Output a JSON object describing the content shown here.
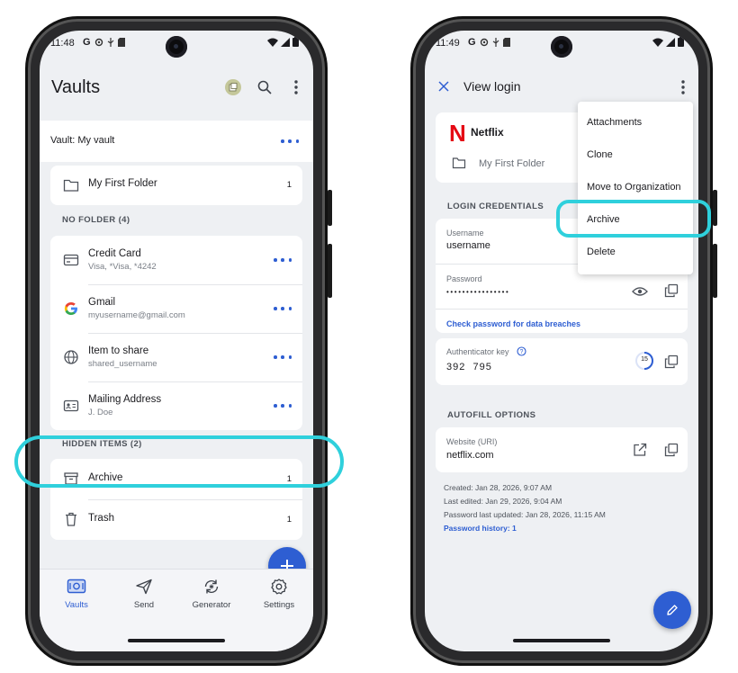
{
  "left_phone": {
    "status_time": "11:48",
    "status_icons": [
      "google-icon",
      "gear-icon",
      "usb-icon",
      "sim-icon"
    ],
    "title": "Vaults",
    "avatar_icon": "account-switch-icon",
    "vault_label": "Vault: My vault",
    "folder": {
      "name": "My First Folder",
      "count": "1"
    },
    "no_folder_label": "NO FOLDER (4)",
    "items": [
      {
        "icon": "card-icon",
        "title": "Credit Card",
        "subtitle": "Visa, *Visa, *4242"
      },
      {
        "icon": "google-g-icon",
        "title": "Gmail",
        "subtitle": "myusername@gmail.com"
      },
      {
        "icon": "globe-icon",
        "title": "Item to share",
        "subtitle": "shared_username"
      },
      {
        "icon": "id-card-icon",
        "title": "Mailing Address",
        "subtitle": "J. Doe"
      }
    ],
    "hidden_label": "HIDDEN ITEMS (2)",
    "hidden_items": [
      {
        "icon": "archive-icon",
        "title": "Archive",
        "count": "1"
      },
      {
        "icon": "trash-icon",
        "title": "Trash",
        "count": "1"
      }
    ],
    "nav": [
      {
        "icon": "vault-icon",
        "label": "Vaults",
        "active": true
      },
      {
        "icon": "send-icon",
        "label": "Send"
      },
      {
        "icon": "generator-icon",
        "label": "Generator"
      },
      {
        "icon": "settings-icon",
        "label": "Settings"
      }
    ]
  },
  "right_phone": {
    "status_time": "11:49",
    "status_icons": [
      "google-icon",
      "gear-icon",
      "usb-icon",
      "sim-icon"
    ],
    "title": "View login",
    "item_name": "Netflix",
    "item_logo": "N",
    "folder_name": "My First Folder",
    "login_credentials_label": "LOGIN CREDENTIALS",
    "username_label": "Username",
    "username_value": "username",
    "password_label": "Password",
    "password_value": "••••••••••••••••",
    "check_password_link": "Check password for data breaches",
    "authenticator_label": "Authenticator key",
    "authenticator_value": "392  795",
    "totp_seconds": "15",
    "autofill_label": "AUTOFILL OPTIONS",
    "website_label": "Website (URI)",
    "website_value": "netflix.com",
    "created": "Created: Jan 28, 2026, 9:07 AM",
    "last_edited": "Last edited: Jan 29, 2026, 9:04 AM",
    "password_updated": "Password last updated: Jan 28, 2026, 11:15 AM",
    "password_history": "Password history: 1",
    "menu": [
      "Attachments",
      "Clone",
      "Move to Organization",
      "Archive",
      "Delete"
    ]
  },
  "colors": {
    "accent": "#2e5ed2",
    "highlight": "#2fd0dc",
    "netflix_red": "#e50914",
    "background": "#eef0f3"
  }
}
